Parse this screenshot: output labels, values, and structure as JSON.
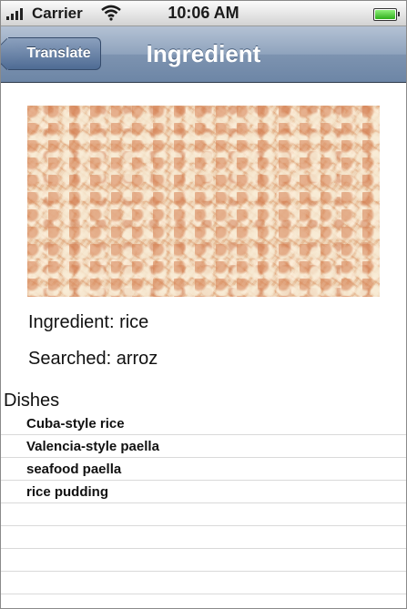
{
  "status_bar": {
    "carrier": "Carrier",
    "time": "10:06 AM",
    "signal_icon": "signal-bars-icon",
    "wifi_icon": "wifi-icon",
    "battery_icon": "battery-icon",
    "battery_level": 1.0
  },
  "nav": {
    "back_label": "Translate",
    "title": "Ingredient"
  },
  "content": {
    "ingredient_line": "Ingredient: rice",
    "searched_line": "Searched: arroz"
  },
  "dishes": {
    "header": "Dishes",
    "items": [
      {
        "label": "Cuba-style rice"
      },
      {
        "label": "Valencia-style paella"
      },
      {
        "label": "seafood paella"
      },
      {
        "label": "rice pudding"
      },
      {
        "label": ""
      },
      {
        "label": ""
      },
      {
        "label": ""
      },
      {
        "label": ""
      }
    ]
  },
  "colors": {
    "nav_bar": "#7d93b0",
    "back_button": "#4e6b94",
    "battery": "#2fae1d"
  }
}
